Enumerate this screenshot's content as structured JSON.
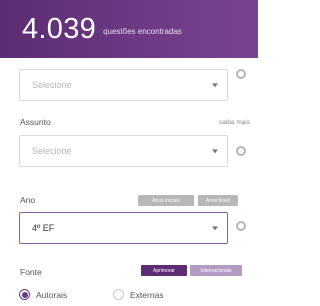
{
  "header": {
    "count": "4.039",
    "count_label": "questões encontradas"
  },
  "first_select": {
    "value": "Selecione"
  },
  "assunto": {
    "label": "Assunto",
    "link": "saiba mais",
    "select": {
      "value": "Selecione"
    }
  },
  "ano": {
    "label": "Ano",
    "chips": [
      "Anos iniciais",
      "Anos finais"
    ],
    "select": {
      "value": "4º EF"
    }
  },
  "fonte": {
    "label": "Fonte",
    "chips": [
      "Aprimorar",
      "Internacionais"
    ],
    "options": [
      {
        "label": "Autorais",
        "checked": true
      },
      {
        "label": "Externas",
        "checked": false
      }
    ]
  },
  "colors": {
    "header": "#6e3a86",
    "accent": "#5e2b75",
    "chip_gray": "#b7b7b7",
    "chip_lavender": "#b49bc3"
  }
}
